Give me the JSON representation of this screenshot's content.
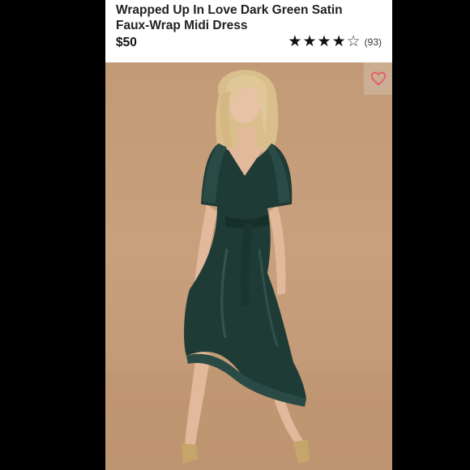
{
  "product": {
    "title": "Wrapped Up In Love Dark Green Satin Faux-Wrap Midi Dress",
    "price": "$50",
    "rating": 4,
    "rating_max": 5,
    "review_count": "(93)"
  },
  "favorite": {
    "icon": "heart-icon",
    "color": "#e0626a"
  },
  "colors": {
    "dress": "#1e3b36",
    "backdrop": "#c9a27f"
  }
}
